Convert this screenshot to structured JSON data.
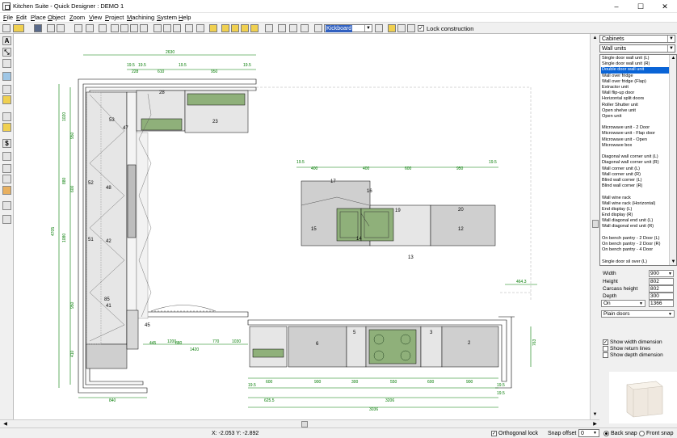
{
  "window": {
    "title": "Kitchen Suite - Quick Designer : DEMO 1",
    "min": "–",
    "max": "☐",
    "close": "✕"
  },
  "menu": [
    {
      "key": "F",
      "rest": "ile"
    },
    {
      "key": "E",
      "rest": "dit"
    },
    {
      "key": "P",
      "rest": "lace"
    },
    {
      "key": "O",
      "rest": "bject"
    },
    {
      "key": "Z",
      "rest": "oom"
    },
    {
      "key": "V",
      "rest": "iew"
    },
    {
      "key": "P",
      "rest": "roject"
    },
    {
      "key": "M",
      "rest": "achining"
    },
    {
      "key": "S",
      "rest": "ystem"
    },
    {
      "key": "H",
      "rest": "elp"
    }
  ],
  "toolbar": {
    "kickboard_value": "Kickboard",
    "lock_construction_label": "Lock construction",
    "lock_checked": "✓"
  },
  "lefttools": [
    "A",
    "⤡",
    "",
    "",
    "",
    "",
    "",
    "",
    "$",
    "",
    "",
    "",
    "",
    "",
    ""
  ],
  "rightpanel": {
    "category": "Cabinets",
    "subcategory": "Wall units",
    "items": [
      "Single door wall unit (L)",
      "Single door wall unit (R)",
      "Double door wall unit",
      "Wall over fridge",
      "Wall over fridge (Flap)",
      "Extractor unit",
      "Wall flip-up door",
      "Horizontal split doors",
      "Roller Shutter unit",
      "Open shelve unit",
      "Open unit",
      "",
      "Microwave unit - 2 Door",
      "Microwave unit - Flap door",
      "Microwave unit - Open",
      "Microwave box",
      "",
      "Diagonal wall corner unit (L)",
      "Diagonal wall corner unit (R)",
      "Wall corner unit (L)",
      "Wall corner unit (R)",
      "Blind wall corner (L)",
      "Blind wall corner (R)",
      "",
      "Wall wine rack",
      "Wall wine rack (Horizontal)",
      "End display (L)",
      "End display (R)",
      "Wall diagonal end unit (L)",
      "Wall diagonal end unit (R)",
      "",
      "On bench pantry - 2 Door (L)",
      "On bench pantry - 2 Door (R)",
      "On bench pantry - 4 Door",
      "",
      "Single door sil over (L)"
    ],
    "selected_index": 2,
    "props": {
      "width_label": "Width",
      "width": "900",
      "height_label": "Height",
      "height": "802",
      "carcass_label": "Carcass height",
      "carcass": "802",
      "depth_label": "Depth",
      "depth": "300",
      "on": "On",
      "elevation": "1366",
      "door_style": "Plain doors"
    },
    "show_width_label": "Show width dimension",
    "show_return_label": "Show return lines",
    "show_depth_label": "Show depth dimension",
    "check_mark": "✓"
  },
  "status": {
    "coords": "X: -2.053   Y: -2.892",
    "ortho_label": "Orthogonal lock",
    "snap_label": "Snap offset",
    "snap_value": "0",
    "back_label": "Back snap",
    "front_label": "Front snap"
  },
  "plan": {
    "top_dims": [
      "2630",
      "19.5",
      "19.5",
      "228",
      "610",
      "19.5",
      "950",
      "19.5"
    ],
    "left_dims": [
      "4705",
      "1020",
      "950",
      "880",
      "600",
      "1080",
      "950",
      "410"
    ],
    "units": [
      "53",
      "28",
      "23",
      "47",
      "52",
      "48",
      "51",
      "42",
      "85",
      "41",
      "45",
      "17",
      "16",
      "15",
      "19",
      "20",
      "12",
      "13",
      "14",
      "6",
      "5",
      "3",
      "2"
    ],
    "island_dims": [
      "19.5",
      "400",
      "400",
      "600",
      "950",
      "19.5"
    ],
    "bottom_dims": [
      "880",
      "1200",
      "1420",
      "445",
      "770",
      "1030",
      "19.5",
      "600",
      "900",
      "300",
      "550",
      "600",
      "900",
      "19.5",
      "625.5",
      "3206",
      "3036",
      "19.5"
    ],
    "right_dims": [
      "464.3",
      "763"
    ],
    "bottom_left_dim": "840"
  }
}
